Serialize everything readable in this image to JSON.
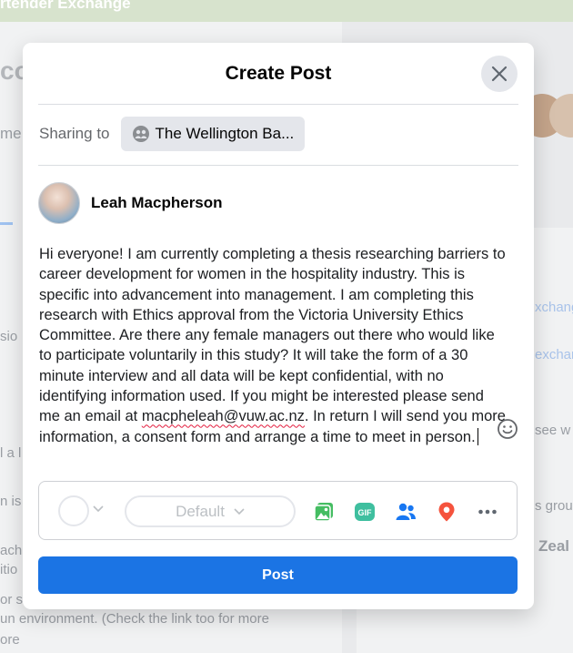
{
  "background": {
    "banner_text": "rtender Exchange",
    "fragments": {
      "co": "co",
      "me": "me",
      "sio": "sio",
      "a_l": "l a l",
      "n_is": "n is",
      "ach": "ach",
      "itio": "itio",
      "or_s": "or s",
      "un_env": "un environment. (Check the link too for more",
      "ore": "ore",
      "xchang": "xchang",
      "exchan": "exchan",
      "see_w": "see w",
      "s_grou": "s grou",
      "zeal": "Zeal"
    }
  },
  "modal": {
    "title": "Create Post",
    "sharing_label": "Sharing to",
    "sharing_target": "The Wellington Ba...",
    "author_name": "Leah Macpherson",
    "post_text_before_email": "Hi everyone! I am currently completing a thesis researching barriers to career development for women in the hospitality industry. This is specific into advancement into management. I am completing this research with Ethics approval from the Victoria University Ethics Committee. Are there any female managers out there who would like to participate voluntarily in this study? It will take the form of a 30 minute interview and all data will be kept confidential, with no identifying information used. If you might be interested please send me an email at ",
    "post_email": "macpheleah@vuw.ac.nz",
    "post_text_after_email": ". In return I will send you more information, a consent form and arrange a time to meet in person.",
    "format_default": "Default",
    "post_button": "Post",
    "toolbar_icons": [
      "photo-video-icon",
      "gif-icon",
      "tag-people-icon",
      "check-in-icon",
      "more-icon"
    ],
    "colors": {
      "primary": "#1b74e4",
      "photo": "#45bd62",
      "gif": "#3fbf9f",
      "tag": "#1877f2",
      "checkin": "#f5533d"
    }
  }
}
